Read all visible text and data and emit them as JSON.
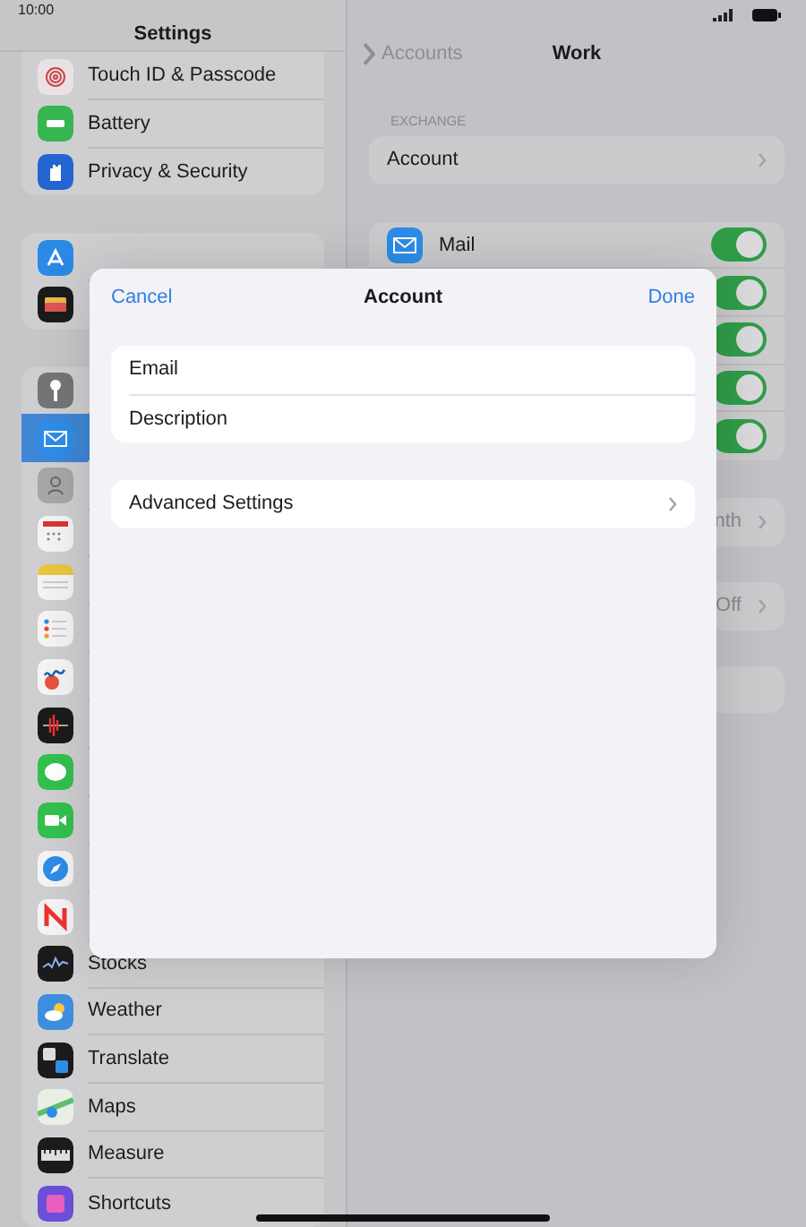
{
  "status_bar": {
    "time": "10:00"
  },
  "sidebar": {
    "title": "Settings",
    "groups": [
      {
        "items": [
          {
            "label": "Touch ID & Passcode",
            "selected": false
          },
          {
            "label": "Battery",
            "selected": false
          },
          {
            "label": "Privacy & Security",
            "selected": false
          }
        ]
      },
      {
        "items": [
          {
            "selected": false
          },
          {
            "selected": false
          }
        ]
      },
      {
        "items": [
          {
            "selected": false
          },
          {
            "selected": true
          },
          {
            "selected": false
          },
          {
            "selected": false
          },
          {
            "selected": false
          },
          {
            "selected": false
          },
          {
            "selected": false
          },
          {
            "selected": false
          },
          {
            "selected": false
          },
          {
            "selected": false
          },
          {
            "selected": false
          },
          {
            "selected": false
          },
          {
            "label": "Stocks",
            "selected": false
          },
          {
            "label": "Weather",
            "selected": false
          },
          {
            "label": "Translate",
            "selected": false
          },
          {
            "label": "Maps",
            "selected": false
          },
          {
            "label": "Measure",
            "selected": false
          },
          {
            "label": "Shortcuts",
            "selected": false
          }
        ]
      }
    ]
  },
  "detail": {
    "back": "Accounts",
    "title": "Work",
    "section": "EXCHANGE",
    "account_row": "Account",
    "toggles": [
      {
        "label": "Mail",
        "on": true
      },
      {
        "on": true
      },
      {
        "on": true
      },
      {
        "on": true
      },
      {
        "on": true
      }
    ],
    "value_rows": [
      {
        "value": "nth"
      },
      {
        "value": "Off"
      },
      {}
    ]
  },
  "sheet": {
    "cancel": "Cancel",
    "title": "Account",
    "done": "Done",
    "fields": [
      {
        "label": "Email"
      },
      {
        "label": "Description"
      }
    ],
    "link_row": "Advanced Settings"
  }
}
